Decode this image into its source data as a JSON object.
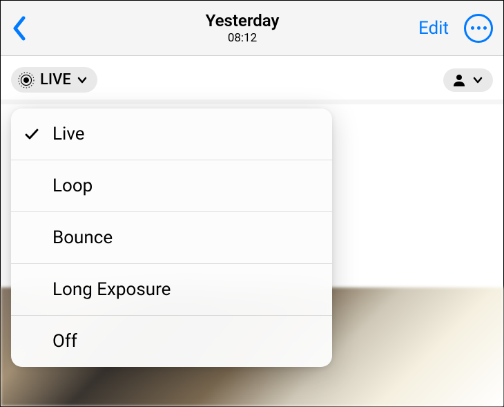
{
  "header": {
    "title": "Yesterday",
    "subtitle": "08:12",
    "edit_label": "Edit"
  },
  "pills": {
    "live_label": "LIVE"
  },
  "menu": {
    "items": [
      {
        "label": "Live",
        "selected": true
      },
      {
        "label": "Loop",
        "selected": false
      },
      {
        "label": "Bounce",
        "selected": false
      },
      {
        "label": "Long Exposure",
        "selected": false
      },
      {
        "label": "Off",
        "selected": false
      }
    ]
  }
}
